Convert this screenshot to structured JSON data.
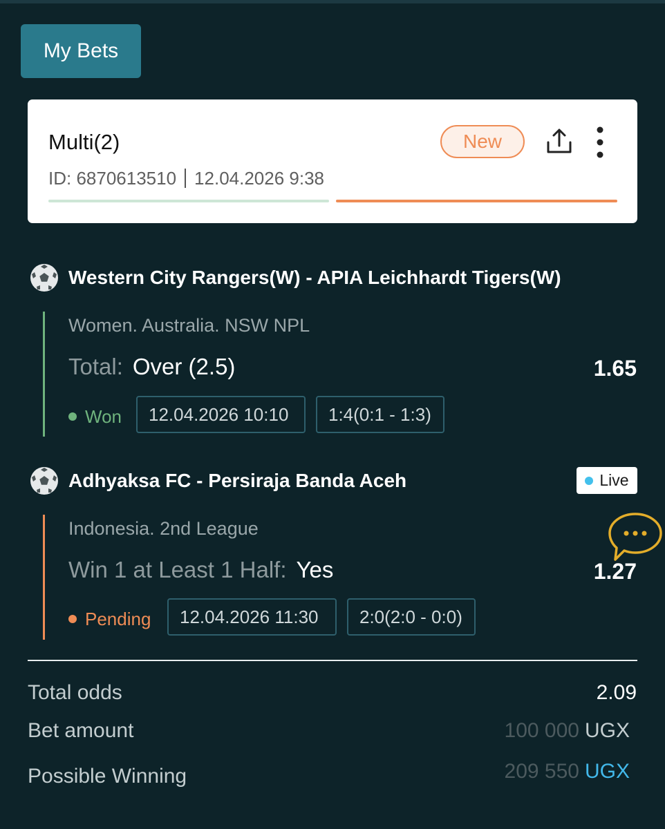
{
  "header": {
    "my_bets_label": "My Bets"
  },
  "bet": {
    "title": "Multi(2)",
    "id_text": "ID: 6870613510",
    "date_text": "12.04.2026 9:38",
    "badge": "New",
    "progress": {
      "won_fraction": 0.5,
      "pending_fraction": 0.5
    }
  },
  "events": [
    {
      "title": "Western City Rangers(W) - APIA Leichhardt Tigers(W)",
      "league": "Women. Australia. NSW NPL",
      "market_label": "Total:",
      "market_value": "Over (2.5)",
      "odds": "1.65",
      "status": "Won",
      "datetime": "12.04.2026 10:10",
      "score": "1:4(0:1 - 1:3)"
    },
    {
      "title": "Adhyaksa FC - Persiraja Banda Aceh",
      "league": "Indonesia. 2nd League",
      "market_label": "Win 1 at Least 1 Half:",
      "market_value": "Yes",
      "odds": "1.27",
      "status": "Pending",
      "datetime": "12.04.2026 11:30",
      "score": "2:0(2:0 - 0:0)",
      "live_label": "Live"
    }
  ],
  "summary": {
    "total_odds_label": "Total odds",
    "total_odds_value": "2.09",
    "bet_amount_label": "Bet amount",
    "bet_amount_value": "100 000",
    "bet_amount_currency": "UGX",
    "possible_winning_label": "Possible Winning",
    "possible_winning_value": "209 550",
    "possible_winning_currency": "UGX"
  },
  "colors": {
    "background": "#0d2329",
    "won": "#6fb37d",
    "pending": "#ef8c55",
    "live": "#43c0ec",
    "accent_button": "#2a7a8c",
    "chat_icon": "#e3ad2a"
  },
  "icons": [
    "soccer-ball-icon",
    "share-icon",
    "more-vertical-icon",
    "chat-bubble-icon",
    "live-dot-icon"
  ]
}
